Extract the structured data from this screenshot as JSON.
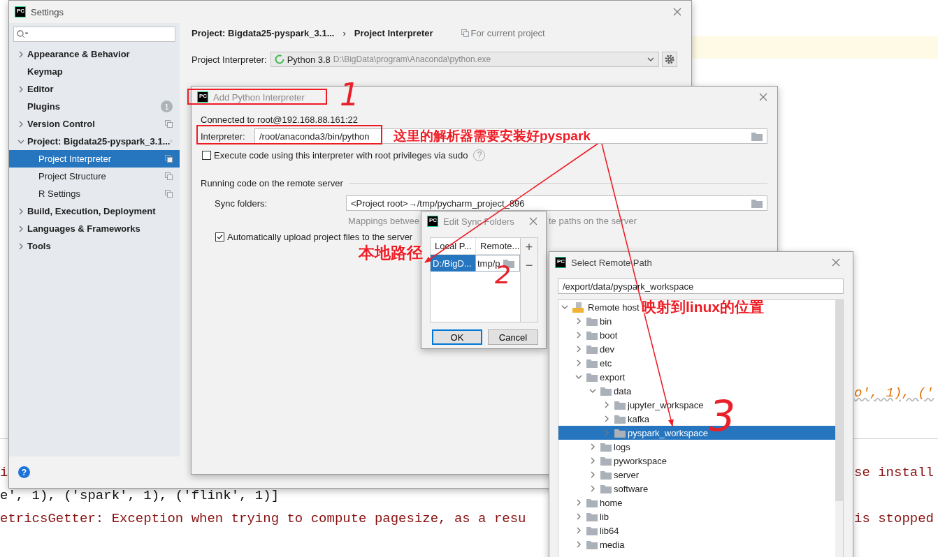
{
  "editor": {
    "code_fragment": "o', 1), ('",
    "console_left": [
      {
        "text": "i",
        "kind": "error"
      },
      {
        "text": "e', 1), ('spark', 1), ('flink', 1)]",
        "kind": "output"
      },
      {
        "text": "etricsGetter: Exception when trying to compute pagesize, as a resu",
        "kind": "error"
      }
    ],
    "console_right": [
      {
        "text": "se install",
        "kind": "error"
      },
      {
        "text": "is stopped",
        "kind": "error"
      }
    ]
  },
  "settings": {
    "app_logo": "PC",
    "title": "Settings",
    "help": "?",
    "sidebar": {
      "items": [
        {
          "label": "Appearance & Behavior",
          "expandable": true,
          "expanded": false,
          "selected": false
        },
        {
          "label": "Keymap",
          "expandable": false,
          "expanded": false,
          "selected": false
        },
        {
          "label": "Editor",
          "expandable": true,
          "expanded": false,
          "selected": false
        },
        {
          "label": "Plugins",
          "expandable": false,
          "expanded": false,
          "selected": false,
          "badge": "1"
        },
        {
          "label": "Version Control",
          "expandable": true,
          "expanded": false,
          "selected": false,
          "project_scoped": true
        },
        {
          "label": "Project: Bigdata25-pyspark_3.1...",
          "expandable": true,
          "expanded": true,
          "selected": false,
          "project_scoped": true,
          "children": [
            {
              "label": "Project Interpreter",
              "expandable": false,
              "expanded": false,
              "selected": true,
              "project_scoped": true
            },
            {
              "label": "Project Structure",
              "expandable": false,
              "expanded": false,
              "selected": false,
              "project_scoped": true
            },
            {
              "label": "R Settings",
              "expandable": false,
              "expanded": false,
              "selected": false,
              "project_scoped": true
            }
          ]
        },
        {
          "label": "Build, Execution, Deployment",
          "expandable": true,
          "expanded": false,
          "selected": false
        },
        {
          "label": "Languages & Frameworks",
          "expandable": true,
          "expanded": false,
          "selected": false
        },
        {
          "label": "Tools",
          "expandable": true,
          "expanded": false,
          "selected": false
        }
      ]
    },
    "breadcrumb": {
      "parent": "Project: Bigdata25-pyspark_3.1...",
      "separator": "›",
      "current": "Project Interpreter",
      "scope": "For current project"
    },
    "interpreter": {
      "label": "Project Interpreter:",
      "name": "Python 3.8",
      "path": "D:\\BigData\\program\\Anaconda\\python.exe"
    }
  },
  "add_interpreter": {
    "app_logo": "PC",
    "title": "Add Python Interpreter",
    "connected": "Connected to root@192.168.88.161:22",
    "interpreter_label": "Interpreter:",
    "interpreter_value": "/root/anaconda3/bin/python",
    "sudo": {
      "label": "Execute code using this interpreter with root privileges via sudo",
      "checked": false,
      "help": "?"
    },
    "section": "Running code on the remote server",
    "sync_label": "Sync folders:",
    "sync_value": "<Project root>→/tmp/pycharm_project_896",
    "hint_parts": [
      "Mappings betwee",
      "te paths on the server"
    ],
    "auto_upload": {
      "label": "Automatically upload project files to the server",
      "checked": true
    }
  },
  "edit_sync": {
    "app_logo": "PC",
    "title": "Edit Sync Folders",
    "columns": [
      "Local P...",
      "Remote..."
    ],
    "rows": [
      {
        "selected": true,
        "cells": [
          {
            "text": "D:/BigD...",
            "kind": "text"
          },
          {
            "text": "tmp/p",
            "kind": "path_editor"
          }
        ]
      }
    ],
    "add": "+",
    "remove": "−",
    "buttons": [
      {
        "label": "OK",
        "default": true
      },
      {
        "label": "Cancel",
        "default": false
      }
    ]
  },
  "remote_path": {
    "app_logo": "PC",
    "title": "Select Remote Path",
    "path": "/export/data/pyspark_workspace",
    "tree": [
      {
        "label": "Remote host",
        "kind": "host",
        "expanded": true,
        "selected": false,
        "children": [
          {
            "label": "bin",
            "kind": "folder",
            "expanded": false,
            "selected": false
          },
          {
            "label": "boot",
            "kind": "folder",
            "expanded": false,
            "selected": false
          },
          {
            "label": "dev",
            "kind": "folder",
            "expanded": false,
            "selected": false
          },
          {
            "label": "etc",
            "kind": "folder",
            "expanded": false,
            "selected": false
          },
          {
            "label": "export",
            "kind": "folder",
            "expanded": true,
            "selected": false,
            "children": [
              {
                "label": "data",
                "kind": "folder",
                "expanded": true,
                "selected": false,
                "children": [
                  {
                    "label": "jupyter_workspace",
                    "kind": "folder",
                    "expanded": false,
                    "selected": false
                  },
                  {
                    "label": "kafka",
                    "kind": "folder",
                    "expanded": false,
                    "selected": false
                  },
                  {
                    "label": "pyspark_workspace",
                    "kind": "folder",
                    "expanded": false,
                    "selected": true
                  }
                ]
              },
              {
                "label": "logs",
                "kind": "folder",
                "expanded": false,
                "selected": false
              },
              {
                "label": "pyworkspace",
                "kind": "folder",
                "expanded": false,
                "selected": false
              },
              {
                "label": "server",
                "kind": "folder",
                "expanded": false,
                "selected": false
              },
              {
                "label": "software",
                "kind": "folder",
                "expanded": false,
                "selected": false
              }
            ]
          },
          {
            "label": "home",
            "kind": "folder",
            "expanded": false,
            "selected": false
          },
          {
            "label": "lib",
            "kind": "folder",
            "expanded": false,
            "selected": false
          },
          {
            "label": "lib64",
            "kind": "folder",
            "expanded": false,
            "selected": false
          },
          {
            "label": "media",
            "kind": "folder",
            "expanded": false,
            "selected": false
          }
        ]
      }
    ]
  },
  "annotations": {
    "callouts": [
      "这里的解析器需要安装好pyspark",
      "本地路径",
      "映射到linux的位置"
    ],
    "step_marks": [
      "1",
      "2",
      "3"
    ]
  }
}
